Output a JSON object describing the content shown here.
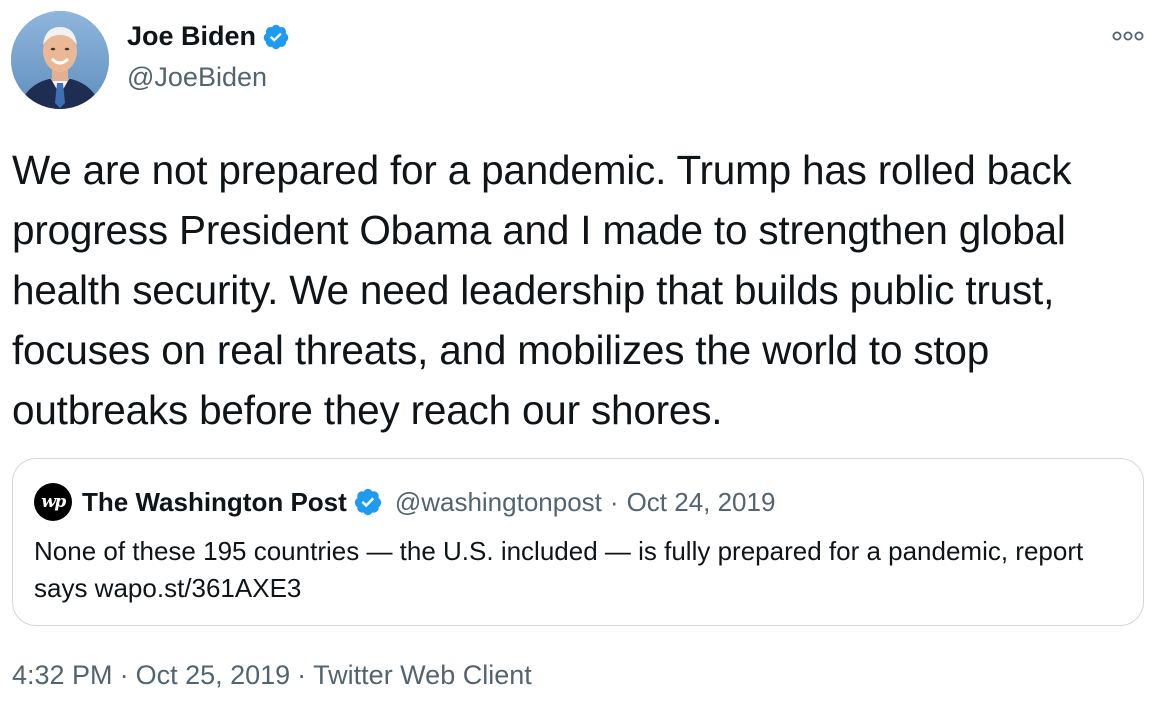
{
  "author": {
    "name": "Joe Biden",
    "handle": "@JoeBiden",
    "avatar_icon": "profile-photo",
    "verified_icon": "verified-badge-icon"
  },
  "more_icon": "more-options-icon",
  "tweet": {
    "text": "We are not prepared for a pandemic. Trump has rolled back progress President Obama and I made to strengthen global health security. We need leadership that builds public trust, focuses on real threats, and mobilizes the world to stop outbreaks before they reach our shores."
  },
  "quote": {
    "logo_text": "wp",
    "name": "The Washington Post",
    "handle": "@washingtonpost",
    "separator": "·",
    "date": "Oct 24, 2019",
    "text": "None of these 195 countries — the U.S. included — is fully prepared for a pandemic, report says wapo.st/361AXE3"
  },
  "footer": {
    "time": "4:32 PM",
    "separator": "·",
    "date": "Oct 25, 2019",
    "source": "Twitter Web Client"
  },
  "colors": {
    "text_primary": "#0f1419",
    "text_secondary": "#536471",
    "verified_blue": "#1d9bf0",
    "border": "#cfd9de"
  }
}
